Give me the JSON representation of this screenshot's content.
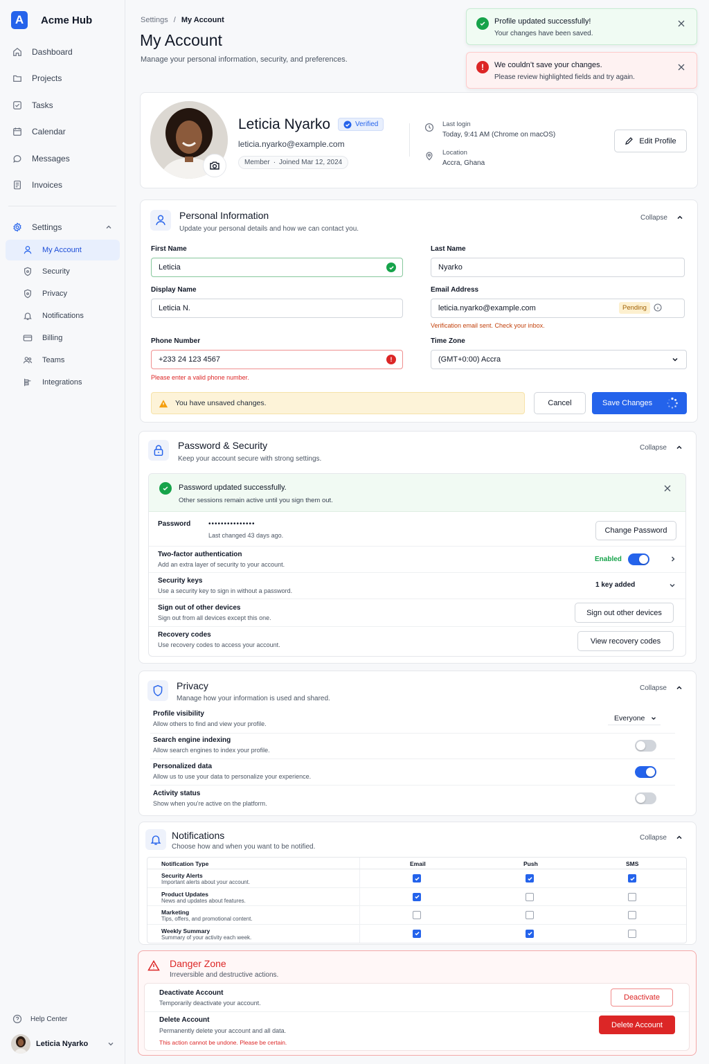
{
  "app": {
    "name": "Acme Hub",
    "logo_letter": "A",
    "brand_color": "#2563eb"
  },
  "sidebar": {
    "items": [
      {
        "label": "Dashboard",
        "icon": "home-icon"
      },
      {
        "label": "Projects",
        "icon": "folder-icon"
      },
      {
        "label": "Tasks",
        "icon": "checkbox-icon"
      },
      {
        "label": "Calendar",
        "icon": "calendar-icon"
      },
      {
        "label": "Messages",
        "icon": "chat-icon"
      },
      {
        "label": "Invoices",
        "icon": "document-icon"
      }
    ],
    "settings_label": "Settings",
    "sub_items": [
      {
        "label": "My Account",
        "icon": "user-icon",
        "active": true
      },
      {
        "label": "Security",
        "icon": "shield-icon"
      },
      {
        "label": "Privacy",
        "icon": "shield-icon"
      },
      {
        "label": "Notifications",
        "icon": "bell-icon"
      },
      {
        "label": "Billing",
        "icon": "card-icon"
      },
      {
        "label": "Teams",
        "icon": "team-icon"
      },
      {
        "label": "Integrations",
        "icon": "plug-icon"
      }
    ],
    "help_label": "Help Center",
    "user_name": "Leticia Nyarko"
  },
  "header": {
    "breadcrumb_root": "Settings",
    "breadcrumb_sep": "/",
    "breadcrumb_current": "My Account",
    "title": "My Account",
    "subtitle": "Manage your personal information, security, and preferences."
  },
  "toasts": {
    "success_title": "Profile updated successfully!",
    "success_msg": "Your changes have been saved.",
    "error_title": "We couldn’t save your changes.",
    "error_msg": "Please review highlighted fields and try again."
  },
  "profile": {
    "name": "Leticia Nyarko",
    "verified_label": "Verified",
    "email": "leticia.nyarko@example.com",
    "member_label": "Member",
    "member_dot": "·",
    "joined": "Joined Mar 12, 2024",
    "last_login_label": "Last login",
    "last_login_value": "Today, 9:41 AM (Chrome on macOS)",
    "location_label": "Location",
    "location_value": "Accra, Ghana",
    "edit_label": "Edit Profile"
  },
  "personal": {
    "title": "Personal Information",
    "subtitle": "Update your personal details and how we can contact you.",
    "collapse_label": "Collapse",
    "first_name_label": "First Name",
    "first_name": "Leticia",
    "last_name_label": "Last Name",
    "last_name": "Nyarko",
    "display_name_label": "Display Name",
    "display_name": "Leticia N.",
    "email_label": "Email Address",
    "email": "leticia.nyarko@example.com",
    "email_status": "Pending",
    "email_hint": "Verification email sent. Check your inbox.",
    "phone_label": "Phone Number",
    "phone": "+233 24 123 4567",
    "phone_error": "Please enter a valid phone number.",
    "tz_label": "Time Zone",
    "tz_value": "(GMT+0:00) Accra",
    "unsaved": "You have unsaved changes.",
    "cancel_label": "Cancel",
    "save_label": "Save Changes"
  },
  "security": {
    "title": "Password & Security",
    "subtitle": "Keep your account secure with strong settings.",
    "collapse_label": "Collapse",
    "banner_title": "Password updated successfully.",
    "banner_msg": "Other sessions remain active until you sign them out.",
    "password_label": "Password",
    "password_mask": "•••••••••••••••",
    "password_changed": "Last changed 43 days ago.",
    "change_password_label": "Change Password",
    "twofa_title": "Two-factor authentication",
    "twofa_sub": "Add an extra layer of security to your account.",
    "twofa_status": "Enabled",
    "keys_title": "Security keys",
    "keys_sub": "Use a security key to sign in without a password.",
    "keys_status": "1 key added",
    "signout_title": "Sign out of other devices",
    "signout_sub": "Sign out from all devices except this one.",
    "signout_label": "Sign out other devices",
    "recovery_title": "Recovery codes",
    "recovery_sub": "Use recovery codes to access your account.",
    "recovery_label": "View recovery codes"
  },
  "privacy": {
    "title": "Privacy",
    "subtitle": "Manage how your information is used and shared.",
    "collapse_label": "Collapse",
    "rows": [
      {
        "title": "Profile visibility",
        "sub": "Allow others to find and view your profile.",
        "control": "select",
        "value": "Everyone"
      },
      {
        "title": "Search engine indexing",
        "sub": "Allow search engines to index your profile.",
        "control": "toggle",
        "on": false
      },
      {
        "title": "Personalized data",
        "sub": "Allow us to use your data to personalize your experience.",
        "control": "toggle",
        "on": true
      },
      {
        "title": "Activity status",
        "sub": "Show when you’re active on the platform.",
        "control": "toggle",
        "on": false
      }
    ]
  },
  "notifications": {
    "title": "Notifications",
    "subtitle": "Choose how and when you want to be notified.",
    "collapse_label": "Collapse",
    "columns": [
      "Notification Type",
      "Email",
      "Push",
      "SMS"
    ],
    "rows": [
      {
        "title": "Security Alerts",
        "sub": "Important alerts about your account.",
        "email": true,
        "push": true,
        "sms": true
      },
      {
        "title": "Product Updates",
        "sub": "News and updates about features.",
        "email": true,
        "push": false,
        "sms": false
      },
      {
        "title": "Marketing",
        "sub": "Tips, offers, and promotional content.",
        "email": false,
        "push": false,
        "sms": false
      },
      {
        "title": "Weekly Summary",
        "sub": "Summary of your activity each week.",
        "email": true,
        "push": true,
        "sms": false
      }
    ]
  },
  "danger": {
    "title": "Danger Zone",
    "subtitle": "Irreversible and destructive actions.",
    "deactivate_title": "Deactivate Account",
    "deactivate_sub": "Temporarily deactivate your account.",
    "deactivate_label": "Deactivate",
    "delete_title": "Delete Account",
    "delete_sub": "Permanently delete your account and all data.",
    "delete_warning": "This action cannot be undone. Please be certain.",
    "delete_label": "Delete Account"
  }
}
